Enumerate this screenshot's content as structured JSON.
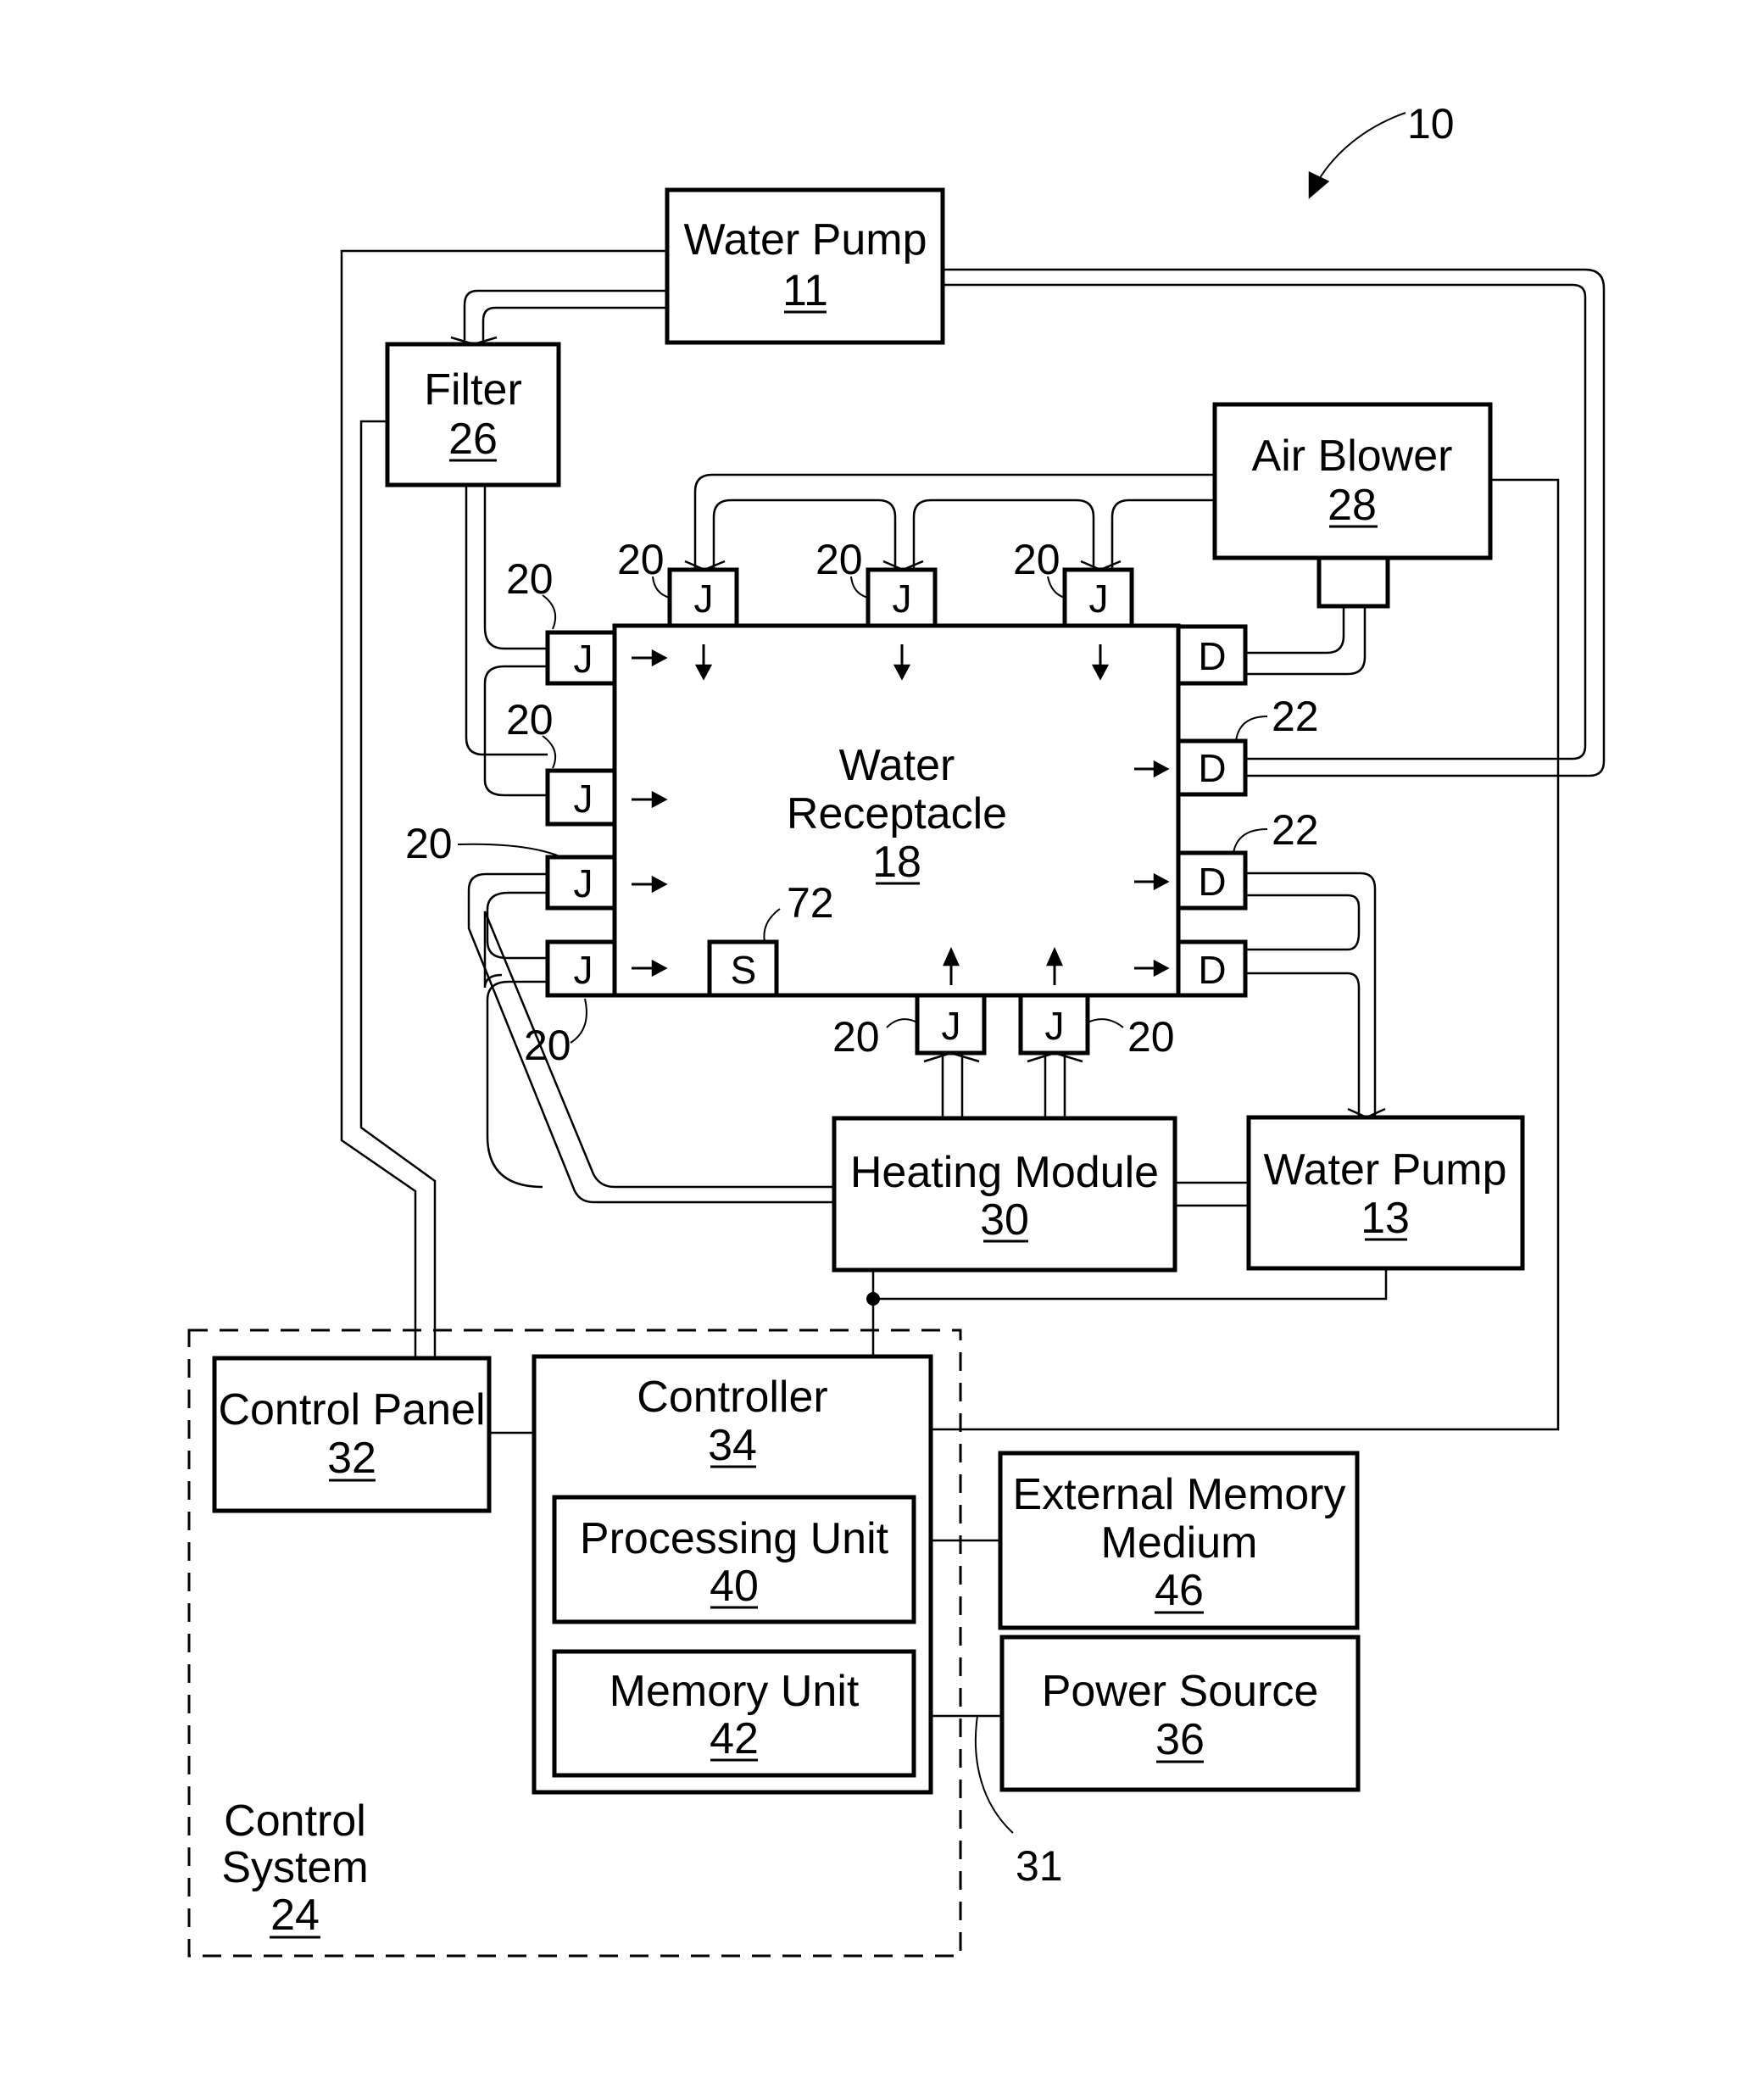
{
  "figure": {
    "reference": "10",
    "components": {
      "water_pump_11": {
        "label": "Water Pump",
        "ref": "11"
      },
      "filter_26": {
        "label": "Filter",
        "ref": "26"
      },
      "air_blower_28": {
        "label": "Air Blower",
        "ref": "28"
      },
      "water_receptacle_18": {
        "label_line1": "Water",
        "label_line2": "Receptacle",
        "ref": "18"
      },
      "heating_module_30": {
        "label": "Heating Module",
        "ref": "30"
      },
      "water_pump_13": {
        "label": "Water Pump",
        "ref": "13"
      },
      "control_panel_32": {
        "label": "Control Panel",
        "ref": "32"
      },
      "controller_34": {
        "label": "Controller",
        "ref": "34"
      },
      "processing_unit_40": {
        "label": "Processing Unit",
        "ref": "40"
      },
      "memory_unit_42": {
        "label": "Memory Unit",
        "ref": "42"
      },
      "external_memory_46": {
        "label_line1": "External Memory",
        "label_line2": "Medium",
        "ref": "46"
      },
      "power_source_36": {
        "label": "Power Source",
        "ref": "36"
      },
      "control_system_24": {
        "label_line1": "Control",
        "label_line2": "System",
        "ref": "24"
      }
    },
    "ports": {
      "jet": "J",
      "drain": "D",
      "sensor": "S"
    },
    "callouts": {
      "jet_ref": "20",
      "drain_ref": "22",
      "sensor_ref": "72",
      "bus_ref": "31"
    }
  }
}
